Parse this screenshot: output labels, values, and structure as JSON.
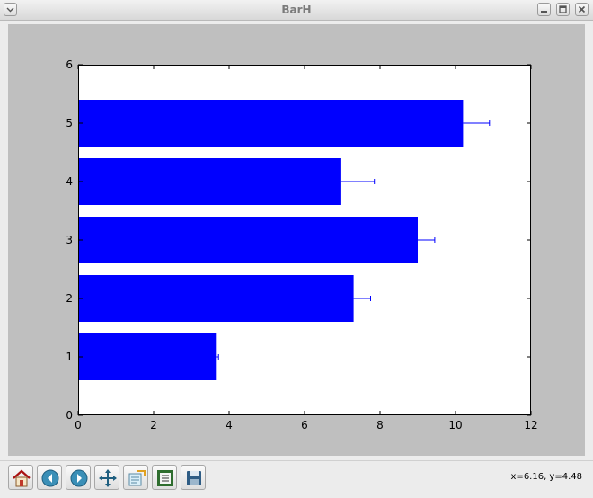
{
  "window": {
    "title": "BarH",
    "controls": {
      "minimize": "minimize-icon",
      "maximize": "maximize-icon",
      "close": "close-icon"
    },
    "menu_icon": "chevron-down-icon"
  },
  "chart_data": {
    "type": "bar",
    "orientation": "horizontal",
    "categories": [
      1,
      2,
      3,
      4,
      5
    ],
    "values": [
      3.65,
      7.3,
      9.0,
      6.95,
      10.2
    ],
    "errors": [
      0.07,
      0.45,
      0.45,
      0.9,
      0.7
    ],
    "title": "",
    "xlabel": "",
    "ylabel": "",
    "xlim": [
      0,
      12
    ],
    "ylim": [
      0,
      6
    ],
    "xticks": [
      "0",
      "2",
      "4",
      "6",
      "8",
      "10",
      "12"
    ],
    "yticks": [
      "0",
      "1",
      "2",
      "3",
      "4",
      "5",
      "6"
    ],
    "bar_color": "#0000ff",
    "error_color": "#0000ff",
    "grid": false
  },
  "toolbar": {
    "tools": [
      {
        "name": "home-icon"
      },
      {
        "name": "back-icon"
      },
      {
        "name": "forward-icon"
      },
      {
        "name": "pan-icon"
      },
      {
        "name": "zoom-icon"
      },
      {
        "name": "subplots-icon"
      },
      {
        "name": "save-icon"
      }
    ],
    "coords": "x=6.16, y=4.48"
  }
}
